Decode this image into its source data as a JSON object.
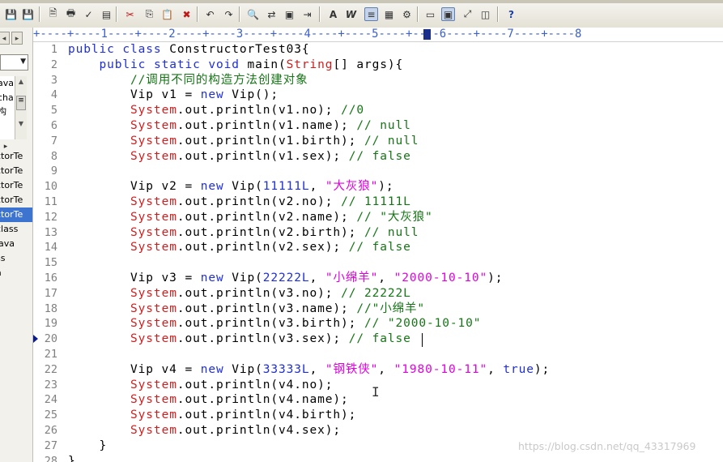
{
  "toolbar": {
    "buttons": [
      {
        "name": "save-icon",
        "glyph": "💾"
      },
      {
        "name": "save-all-icon",
        "glyph": "💾"
      },
      {
        "name": "print-preview-icon",
        "glyph": "🗎"
      },
      {
        "name": "print-icon",
        "glyph": "🖶"
      },
      {
        "name": "spell-check-icon",
        "glyph": "✓"
      },
      {
        "name": "page-setup-icon",
        "glyph": "▤"
      },
      {
        "name": "cut-icon",
        "glyph": "✂"
      },
      {
        "name": "copy-icon",
        "glyph": "⎘"
      },
      {
        "name": "paste-icon",
        "glyph": "📋"
      },
      {
        "name": "delete-icon",
        "glyph": "✖"
      },
      {
        "name": "undo-icon",
        "glyph": "↶"
      },
      {
        "name": "redo-icon",
        "glyph": "↷"
      },
      {
        "name": "find-icon",
        "glyph": "🔍"
      },
      {
        "name": "replace-icon",
        "glyph": "⇄"
      },
      {
        "name": "find-in-files-icon",
        "glyph": "▣"
      },
      {
        "name": "goto-icon",
        "glyph": "⇥"
      },
      {
        "name": "font-icon",
        "glyph": "A"
      },
      {
        "name": "word-wrap-icon",
        "glyph": "W"
      },
      {
        "name": "line-numbers-icon",
        "glyph": "≡"
      },
      {
        "name": "column-mode-icon",
        "glyph": "▦"
      },
      {
        "name": "settings-icon",
        "glyph": "⚙"
      },
      {
        "name": "view-normal-icon",
        "glyph": "▭"
      },
      {
        "name": "view-layout-icon",
        "glyph": "▣"
      },
      {
        "name": "view-fullscreen-icon",
        "glyph": "⤢"
      },
      {
        "name": "view-browser-icon",
        "glyph": "◫"
      },
      {
        "name": "help-icon",
        "glyph": "?"
      }
    ]
  },
  "left_panel": {
    "nav_prev": "◂",
    "nav_next": "▸",
    "combo_arrow": "▼",
    "tree_items": [
      "ava",
      "cha",
      "构"
    ],
    "expand": "▸",
    "files": [
      "ctorTe",
      "ctorTe",
      "ctorTe",
      "ctorTe",
      "ctorTe",
      "class",
      "java",
      "ss",
      "a"
    ],
    "selected_index": 4
  },
  "ruler": {
    "text": "+----+----1----+----2----+----3----+----4----+----5----+----6----+----7----+----8"
  },
  "editor": {
    "lines": [
      {
        "n": "1",
        "parts": [
          [
            "kw",
            "public class "
          ],
          [
            "pl",
            "ConstructorTest03{"
          ]
        ]
      },
      {
        "n": "2",
        "parts": [
          [
            "pl",
            "    "
          ],
          [
            "kw",
            "public static void "
          ],
          [
            "pl",
            "main("
          ],
          [
            "sys",
            "String"
          ],
          [
            "pl",
            "[] args){"
          ]
        ]
      },
      {
        "n": "3",
        "parts": [
          [
            "pl",
            "        "
          ],
          [
            "cm",
            "//调用不同的构造方法创建对象"
          ]
        ]
      },
      {
        "n": "4",
        "parts": [
          [
            "pl",
            "        Vip v1 = "
          ],
          [
            "kw",
            "new "
          ],
          [
            "pl",
            "Vip();"
          ]
        ]
      },
      {
        "n": "5",
        "parts": [
          [
            "pl",
            "        "
          ],
          [
            "sys",
            "System"
          ],
          [
            "pl",
            ".out.println(v1.no); "
          ],
          [
            "cm",
            "//0"
          ]
        ]
      },
      {
        "n": "6",
        "parts": [
          [
            "pl",
            "        "
          ],
          [
            "sys",
            "System"
          ],
          [
            "pl",
            ".out.println(v1.name); "
          ],
          [
            "cm",
            "// null"
          ]
        ]
      },
      {
        "n": "7",
        "parts": [
          [
            "pl",
            "        "
          ],
          [
            "sys",
            "System"
          ],
          [
            "pl",
            ".out.println(v1.birth); "
          ],
          [
            "cm",
            "// null"
          ]
        ]
      },
      {
        "n": "8",
        "parts": [
          [
            "pl",
            "        "
          ],
          [
            "sys",
            "System"
          ],
          [
            "pl",
            ".out.println(v1.sex); "
          ],
          [
            "cm",
            "// false"
          ]
        ]
      },
      {
        "n": "9",
        "parts": []
      },
      {
        "n": "10",
        "parts": [
          [
            "pl",
            "        Vip v2 = "
          ],
          [
            "kw",
            "new "
          ],
          [
            "pl",
            "Vip("
          ],
          [
            "num",
            "11111L"
          ],
          [
            "pl",
            ", "
          ],
          [
            "str",
            "\"大灰狼\""
          ],
          [
            "pl",
            ");"
          ]
        ]
      },
      {
        "n": "11",
        "parts": [
          [
            "pl",
            "        "
          ],
          [
            "sys",
            "System"
          ],
          [
            "pl",
            ".out.println(v2.no); "
          ],
          [
            "cm",
            "// 11111L"
          ]
        ]
      },
      {
        "n": "12",
        "parts": [
          [
            "pl",
            "        "
          ],
          [
            "sys",
            "System"
          ],
          [
            "pl",
            ".out.println(v2.name); "
          ],
          [
            "cm",
            "// \"大灰狼\""
          ]
        ]
      },
      {
        "n": "13",
        "parts": [
          [
            "pl",
            "        "
          ],
          [
            "sys",
            "System"
          ],
          [
            "pl",
            ".out.println(v2.birth); "
          ],
          [
            "cm",
            "// null"
          ]
        ]
      },
      {
        "n": "14",
        "parts": [
          [
            "pl",
            "        "
          ],
          [
            "sys",
            "System"
          ],
          [
            "pl",
            ".out.println(v2.sex); "
          ],
          [
            "cm",
            "// false"
          ]
        ]
      },
      {
        "n": "15",
        "parts": []
      },
      {
        "n": "16",
        "parts": [
          [
            "pl",
            "        Vip v3 = "
          ],
          [
            "kw",
            "new "
          ],
          [
            "pl",
            "Vip("
          ],
          [
            "num",
            "22222L"
          ],
          [
            "pl",
            ", "
          ],
          [
            "str",
            "\"小绵羊\""
          ],
          [
            "pl",
            ", "
          ],
          [
            "str",
            "\"2000-10-10\""
          ],
          [
            "pl",
            ");"
          ]
        ]
      },
      {
        "n": "17",
        "parts": [
          [
            "pl",
            "        "
          ],
          [
            "sys",
            "System"
          ],
          [
            "pl",
            ".out.println(v3.no); "
          ],
          [
            "cm",
            "// 22222L"
          ]
        ]
      },
      {
        "n": "18",
        "parts": [
          [
            "pl",
            "        "
          ],
          [
            "sys",
            "System"
          ],
          [
            "pl",
            ".out.println(v3.name); "
          ],
          [
            "cm",
            "//\"小绵羊\""
          ]
        ]
      },
      {
        "n": "19",
        "parts": [
          [
            "pl",
            "        "
          ],
          [
            "sys",
            "System"
          ],
          [
            "pl",
            ".out.println(v3.birth); "
          ],
          [
            "cm",
            "// \"2000-10-10\""
          ]
        ]
      },
      {
        "n": "20",
        "parts": [
          [
            "pl",
            "        "
          ],
          [
            "sys",
            "System"
          ],
          [
            "pl",
            ".out.println(v3.sex); "
          ],
          [
            "cm",
            "// false"
          ]
        ],
        "bookmark": true
      },
      {
        "n": "21",
        "parts": []
      },
      {
        "n": "22",
        "parts": [
          [
            "pl",
            "        Vip v4 = "
          ],
          [
            "kw",
            "new "
          ],
          [
            "pl",
            "Vip("
          ],
          [
            "num",
            "33333L"
          ],
          [
            "pl",
            ", "
          ],
          [
            "str",
            "\"钢铁侠\""
          ],
          [
            "pl",
            ", "
          ],
          [
            "str",
            "\"1980-10-11\""
          ],
          [
            "pl",
            ", "
          ],
          [
            "kw",
            "true"
          ],
          [
            "pl",
            ");"
          ]
        ]
      },
      {
        "n": "23",
        "parts": [
          [
            "pl",
            "        "
          ],
          [
            "sys",
            "System"
          ],
          [
            "pl",
            ".out.println(v4.no);"
          ]
        ]
      },
      {
        "n": "24",
        "parts": [
          [
            "pl",
            "        "
          ],
          [
            "sys",
            "System"
          ],
          [
            "pl",
            ".out.println(v4.name);"
          ]
        ]
      },
      {
        "n": "25",
        "parts": [
          [
            "pl",
            "        "
          ],
          [
            "sys",
            "System"
          ],
          [
            "pl",
            ".out.println(v4.birth);"
          ]
        ]
      },
      {
        "n": "26",
        "parts": [
          [
            "pl",
            "        "
          ],
          [
            "sys",
            "System"
          ],
          [
            "pl",
            ".out.println(v4.sex);"
          ]
        ]
      },
      {
        "n": "27",
        "parts": [
          [
            "pl",
            "    }"
          ]
        ]
      },
      {
        "n": "28",
        "parts": [
          [
            "pl",
            "}"
          ]
        ]
      }
    ]
  },
  "watermark": "https://blog.csdn.net/qq_43317969",
  "colors": {
    "keyword": "#1f2fd6",
    "string": "#e000e0",
    "system": "#d11d1d",
    "comment": "#157515",
    "ruler": "#3c5fc8",
    "selection": "#3d74d0"
  }
}
